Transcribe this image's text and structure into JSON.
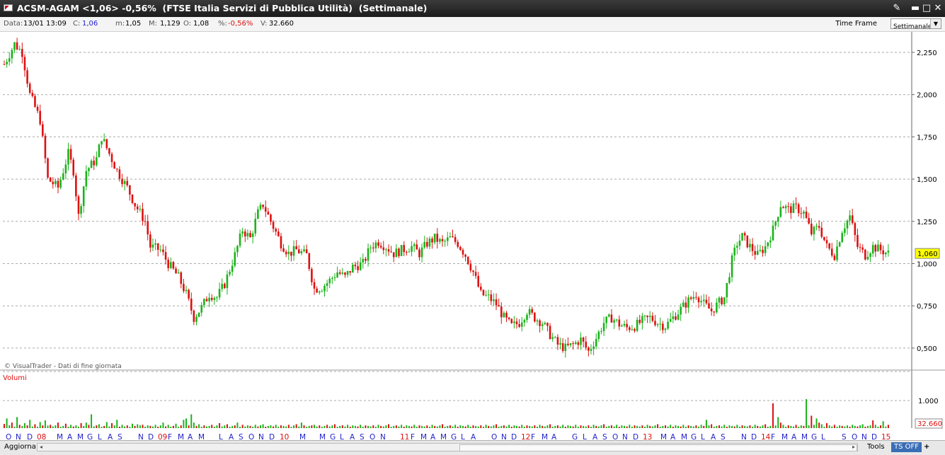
{
  "window": {
    "title": "ACSM-AGAM <1,06> -0,56%  (FTSE Italia Servizi di Pubblica Utilità)  (Settimanale)",
    "controls": [
      "✎",
      "▬",
      "□",
      "✕"
    ]
  },
  "infobar": {
    "data_label": "Data:",
    "data_value": "13/01 13:09",
    "c_label": "C:",
    "c_value": "1,06",
    "m_label": "m:",
    "m_value": "1,05",
    "M_label": "M:",
    "M_value": "1,129",
    "o_label": "O:",
    "o_value": "1,08",
    "pct_label": "%:",
    "pct_value": "-0,56%",
    "v_label": "V:",
    "v_value": "32.660",
    "time_frame_label": "Time Frame",
    "time_frame_value": "Settimanale"
  },
  "colors": {
    "up": "#1bb31b",
    "down": "#dd1111",
    "grid": "#aaaaaa",
    "accent": "#2222cc",
    "year": "#dd1111",
    "price_tag": "#ffff00"
  },
  "chart_data": {
    "type": "candlestick",
    "price_axis": {
      "ticks": [
        "2,250",
        "2,000",
        "1,750",
        "1,500",
        "1,250",
        "1,000",
        "0,750",
        "0,500"
      ],
      "tick_values": [
        2.25,
        2.0,
        1.75,
        1.5,
        1.25,
        1.0,
        0.75,
        0.5
      ],
      "range": [
        0.4,
        2.35
      ]
    },
    "last_price_label": "1,060",
    "watermark": "© VisualTrader - Dati di fine giornata",
    "volume_panel": {
      "label": "Volumi",
      "ticks": [
        "1.000"
      ],
      "tick_values": [
        1000
      ],
      "last_volume_label": "32.660"
    },
    "price_path": [
      [
        0,
        2.18
      ],
      [
        4,
        2.3
      ],
      [
        7,
        2.25
      ],
      [
        10,
        2.0
      ],
      [
        14,
        1.85
      ],
      [
        17,
        1.5
      ],
      [
        21,
        1.45
      ],
      [
        25,
        1.65
      ],
      [
        27,
        1.55
      ],
      [
        29,
        1.28
      ],
      [
        32,
        1.55
      ],
      [
        36,
        1.62
      ],
      [
        38,
        1.75
      ],
      [
        41,
        1.65
      ],
      [
        44,
        1.55
      ],
      [
        48,
        1.45
      ],
      [
        51,
        1.35
      ],
      [
        55,
        1.25
      ],
      [
        57,
        1.1
      ],
      [
        61,
        1.08
      ],
      [
        64,
        1.0
      ],
      [
        68,
        0.92
      ],
      [
        71,
        0.82
      ],
      [
        74,
        0.68
      ],
      [
        77,
        0.74
      ],
      [
        80,
        0.82
      ],
      [
        83,
        0.8
      ],
      [
        86,
        0.88
      ],
      [
        90,
        1.05
      ],
      [
        93,
        1.2
      ],
      [
        96,
        1.15
      ],
      [
        99,
        1.3
      ],
      [
        101,
        1.35
      ],
      [
        104,
        1.25
      ],
      [
        108,
        1.12
      ],
      [
        111,
        1.06
      ],
      [
        114,
        1.08
      ],
      [
        118,
        1.05
      ],
      [
        121,
        0.85
      ],
      [
        124,
        0.86
      ],
      [
        127,
        0.9
      ],
      [
        130,
        0.95
      ],
      [
        133,
        0.92
      ],
      [
        136,
        0.98
      ],
      [
        140,
        1.0
      ],
      [
        143,
        1.1
      ],
      [
        146,
        1.13
      ],
      [
        149,
        1.1
      ],
      [
        152,
        1.06
      ],
      [
        155,
        1.08
      ],
      [
        159,
        1.1
      ],
      [
        162,
        1.06
      ],
      [
        165,
        1.12
      ],
      [
        168,
        1.15
      ],
      [
        171,
        1.12
      ],
      [
        174,
        1.15
      ],
      [
        177,
        1.12
      ],
      [
        180,
        1.05
      ],
      [
        183,
        0.95
      ],
      [
        186,
        0.82
      ],
      [
        189,
        0.8
      ],
      [
        192,
        0.76
      ],
      [
        195,
        0.68
      ],
      [
        198,
        0.63
      ],
      [
        201,
        0.65
      ],
      [
        204,
        0.72
      ],
      [
        207,
        0.68
      ],
      [
        210,
        0.65
      ],
      [
        213,
        0.58
      ],
      [
        216,
        0.52
      ],
      [
        219,
        0.5
      ],
      [
        222,
        0.52
      ],
      [
        225,
        0.55
      ],
      [
        228,
        0.48
      ],
      [
        231,
        0.56
      ],
      [
        234,
        0.65
      ],
      [
        237,
        0.68
      ],
      [
        240,
        0.64
      ],
      [
        243,
        0.62
      ],
      [
        246,
        0.63
      ],
      [
        249,
        0.66
      ],
      [
        252,
        0.68
      ],
      [
        255,
        0.65
      ],
      [
        258,
        0.63
      ],
      [
        261,
        0.68
      ],
      [
        264,
        0.73
      ],
      [
        267,
        0.78
      ],
      [
        270,
        0.82
      ],
      [
        273,
        0.76
      ],
      [
        276,
        0.72
      ],
      [
        279,
        0.77
      ],
      [
        281,
        0.8
      ],
      [
        284,
        1.02
      ],
      [
        286,
        1.12
      ],
      [
        288,
        1.16
      ],
      [
        291,
        1.1
      ],
      [
        294,
        1.05
      ],
      [
        297,
        1.1
      ],
      [
        300,
        1.2
      ],
      [
        303,
        1.35
      ],
      [
        306,
        1.32
      ],
      [
        309,
        1.33
      ],
      [
        312,
        1.3
      ],
      [
        315,
        1.18
      ],
      [
        318,
        1.22
      ],
      [
        321,
        1.1
      ],
      [
        324,
        1.05
      ],
      [
        327,
        1.2
      ],
      [
        330,
        1.28
      ],
      [
        333,
        1.1
      ],
      [
        336,
        1.05
      ],
      [
        339,
        1.1
      ],
      [
        342,
        1.08
      ],
      [
        345,
        1.06
      ]
    ],
    "volume_heights": [
      0.15,
      0.35,
      0.1,
      0.2,
      0.05,
      0.4,
      0.12,
      0.08,
      0.18,
      0.1,
      0.3,
      0.06,
      0.14,
      0.05,
      0.22,
      0.1,
      0.28,
      0.09,
      0.12,
      0.06,
      0.1,
      0.2,
      0.05,
      0.08,
      0.16,
      0.05,
      0.12,
      0.06,
      0.1,
      0.05,
      0.18,
      0.08,
      0.2,
      0.12,
      0.5,
      0.06,
      0.1,
      0.14,
      0.05,
      0.08,
      0.22,
      0.06,
      0.18,
      0.1,
      0.3,
      0.05,
      0.12,
      0.06,
      0.1,
      0.05,
      0.16,
      0.08,
      0.14,
      0.1,
      0.12,
      0.05,
      0.1,
      0.08,
      0.06,
      0.12,
      0.05,
      0.1,
      0.2,
      0.06,
      0.12,
      0.05,
      0.08,
      0.16,
      0.05,
      0.1,
      0.3,
      0.35,
      0.1,
      0.5,
      0.2,
      0.08,
      0.14,
      0.05,
      0.1,
      0.06,
      0.08,
      0.12,
      0.05,
      0.1,
      0.18,
      0.06,
      0.1,
      0.14,
      0.05,
      0.08,
      0.1,
      0.2,
      0.05,
      0.12,
      0.06,
      0.1,
      0.08,
      0.05,
      0.12,
      0.06,
      0.1,
      0.14,
      0.05,
      0.08,
      0.1,
      0.06,
      0.12,
      0.05,
      0.1,
      0.08,
      0.06,
      0.12,
      0.05,
      0.1,
      0.14,
      0.06,
      0.2,
      0.1,
      0.05,
      0.08,
      0.1,
      0.12,
      0.06,
      0.1,
      0.05,
      0.08,
      0.12,
      0.06,
      0.1,
      0.14,
      0.05,
      0.08,
      0.1,
      0.06,
      0.12,
      0.05,
      0.1,
      0.08,
      0.06,
      0.12,
      0.05,
      0.1,
      0.08,
      0.06,
      0.1,
      0.05,
      0.12,
      0.08,
      0.06,
      0.1,
      0.14,
      0.05,
      0.08,
      0.1,
      0.06,
      0.12,
      0.05,
      0.1,
      0.08,
      0.06,
      0.12,
      0.05,
      0.1,
      0.08,
      0.06,
      0.1,
      0.05,
      0.12,
      0.08,
      0.06,
      0.1,
      0.14,
      0.05,
      0.08,
      0.1,
      0.06,
      0.12,
      0.05,
      0.1,
      0.08,
      0.06,
      0.12,
      0.05,
      0.1,
      0.08,
      0.06,
      0.1,
      0.05,
      0.12,
      0.08,
      0.06,
      0.1,
      0.14,
      0.05,
      0.08,
      0.1,
      0.06,
      0.12,
      0.05,
      0.1,
      0.08,
      0.06,
      0.12,
      0.05,
      0.1,
      0.08,
      0.06,
      0.1,
      0.05,
      0.12,
      0.08,
      0.06,
      0.1,
      0.14,
      0.05,
      0.08,
      0.1,
      0.06,
      0.12,
      0.05,
      0.1,
      0.08,
      0.06,
      0.12,
      0.05,
      0.1,
      0.08,
      0.06,
      0.1,
      0.05,
      0.12,
      0.08,
      0.06,
      0.1,
      0.14,
      0.05,
      0.08,
      0.1,
      0.06,
      0.12,
      0.05,
      0.1,
      0.08,
      0.06,
      0.12,
      0.05,
      0.1,
      0.08,
      0.06,
      0.1,
      0.05,
      0.12,
      0.08,
      0.06,
      0.1,
      0.14,
      0.05,
      0.08,
      0.1,
      0.06,
      0.12,
      0.05,
      0.1,
      0.08,
      0.06,
      0.12,
      0.05,
      0.1,
      0.08,
      0.06,
      0.1,
      0.05,
      0.12,
      0.08,
      0.3,
      0.1,
      0.14,
      0.05,
      0.08,
      0.1,
      0.06,
      0.12,
      0.05,
      0.1,
      0.08,
      0.06,
      0.12,
      0.05,
      0.1,
      0.08,
      0.06,
      0.1,
      0.05,
      0.12,
      0.08,
      0.06,
      0.1,
      0.14,
      0.05,
      0.08,
      0.9,
      0.1,
      0.4,
      0.2,
      0.12,
      0.05,
      0.1,
      0.08,
      0.06,
      0.12,
      0.05,
      0.1,
      0.08,
      1.05,
      0.1,
      0.45,
      0.12,
      0.35,
      0.2,
      0.14,
      0.05,
      0.18,
      0.1,
      0.06,
      0.12,
      0.05,
      0.1,
      0.08,
      0.06,
      0.1,
      0.05,
      0.12,
      0.08,
      0.06,
      0.1,
      0.14,
      0.05,
      0.08,
      0.1,
      0.28,
      0.12,
      0.05,
      0.1,
      0.25,
      0.06,
      0.12,
      0.05,
      0.1,
      0.08,
      0.06,
      0.1,
      0.05,
      0.12,
      0.08
    ],
    "time_labels": [
      "O",
      "N",
      "D",
      "08",
      "M",
      "A",
      "M",
      "G",
      "L",
      "A",
      "S",
      "N",
      "D",
      "09",
      "F",
      "M",
      "A",
      "M",
      "L",
      "A",
      "S",
      "O",
      "N",
      "D",
      "10",
      "M",
      "M",
      "G",
      "L",
      "A",
      "S",
      "O",
      "N",
      "11",
      "F",
      "M",
      "A",
      "M",
      "G",
      "L",
      "A",
      "O",
      "N",
      "D",
      "12",
      "F",
      "M",
      "A",
      "G",
      "L",
      "A",
      "S",
      "O",
      "N",
      "D",
      "13",
      "M",
      "A",
      "M",
      "G",
      "L",
      "A",
      "S",
      "N",
      "D",
      "14",
      "F",
      "M",
      "A",
      "M",
      "G",
      "L",
      "S",
      "O",
      "N",
      "D",
      "15"
    ],
    "time_label_pos": [
      8,
      22,
      38,
      52,
      80,
      95,
      109,
      123,
      138,
      152,
      166,
      195,
      209,
      223,
      237,
      251,
      265,
      280,
      309,
      323,
      337,
      351,
      365,
      380,
      395,
      423,
      451,
      466,
      480,
      494,
      508,
      522,
      537,
      565,
      580,
      594,
      608,
      622,
      637,
      651,
      665,
      694,
      708,
      722,
      736,
      750,
      765,
      779,
      808,
      823,
      837,
      851,
      865,
      879,
      894,
      908,
      933,
      947,
      962,
      976,
      990,
      1004,
      1018,
      1047,
      1061,
      1075,
      1089,
      1104,
      1118,
      1132,
      1146,
      1160,
      1189,
      1203,
      1217,
      1231,
      1245
    ],
    "year_labels": [
      "08",
      "09",
      "10",
      "11",
      "12",
      "13",
      "14",
      "15"
    ]
  },
  "bottombar": {
    "refresh_label": "Aggiorna",
    "tools_label": "Tools",
    "ts_label": "TS OFF",
    "plus_label": "+",
    "arrows": [
      "◂",
      "▸"
    ]
  }
}
